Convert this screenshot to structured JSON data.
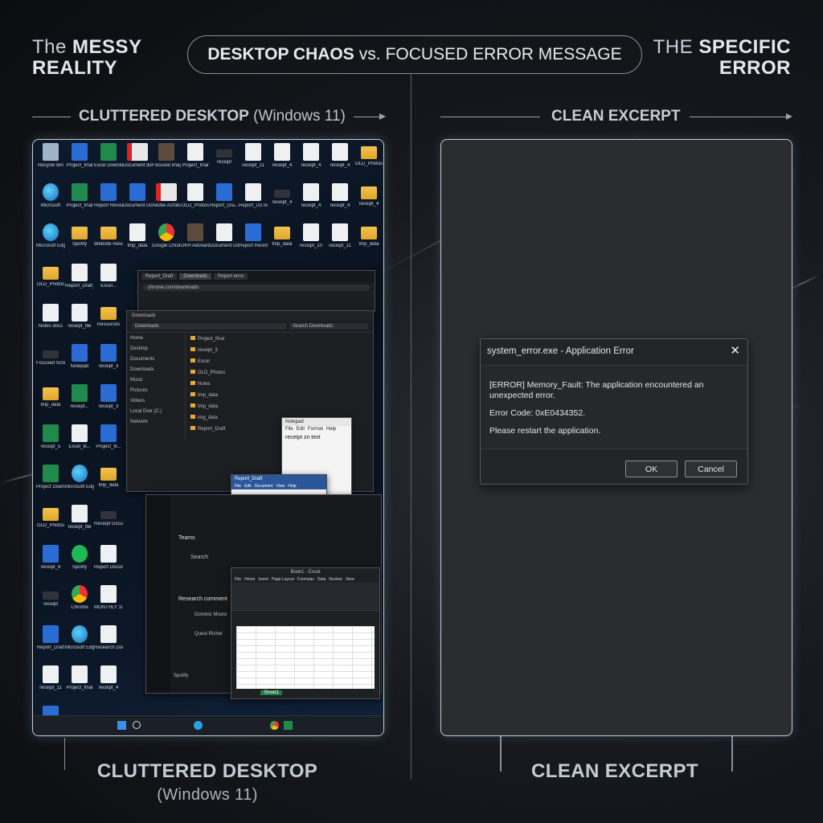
{
  "header": {
    "left_thin": "The",
    "left_bold1": "MESSY",
    "left_bold2": "REALITY",
    "center_bold": "DESKTOP CHAOS",
    "center_thin": "vs.",
    "center_rest": "FOCUSED ERROR MESSAGE",
    "right_thin": "THE",
    "right_bold1": "SPECIFIC",
    "right_bold2": "ERROR"
  },
  "left_section": {
    "label_bold": "CLUTTERED DESKTOP",
    "label_thin": "(Windows 11)"
  },
  "right_section": {
    "label_bold": "CLEAN EXCERPT"
  },
  "desktop": {
    "icons": [
      {
        "t": "Recycle Bin",
        "k": "bin"
      },
      {
        "t": "Project_final",
        "k": "word"
      },
      {
        "t": "Excel Download",
        "k": "excel"
      },
      {
        "t": "Document docs",
        "k": "pdf"
      },
      {
        "t": "Focused image",
        "k": "img"
      },
      {
        "t": "Project_final",
        "k": "doc"
      },
      {
        "t": "receipt",
        "k": "zip"
      },
      {
        "t": "receipt_11",
        "k": "doc"
      },
      {
        "t": "receipt_4",
        "k": "doc"
      },
      {
        "t": "receipt_4",
        "k": "doc"
      },
      {
        "t": "receipt_4",
        "k": "doc"
      },
      {
        "t": "OLD_Photos",
        "k": "folder"
      },
      {
        "t": "Microsoft",
        "k": "edge"
      },
      {
        "t": "Project_final",
        "k": "excel"
      },
      {
        "t": "Report Revised",
        "k": "word"
      },
      {
        "t": "Document Download",
        "k": "word"
      },
      {
        "t": "Adobe Acrobat",
        "k": "pdf"
      },
      {
        "t": "OLD_Photos",
        "k": "doc"
      },
      {
        "t": "Report_Dra...",
        "k": "word"
      },
      {
        "t": "Report_U3 receipts",
        "k": "doc"
      },
      {
        "t": "receipt_4",
        "k": "zip"
      },
      {
        "t": "receipt_4",
        "k": "doc"
      },
      {
        "t": "receipt_4",
        "k": "doc"
      },
      {
        "t": "receipt_4",
        "k": "folder"
      },
      {
        "t": "Microsoft Edge",
        "k": "edge"
      },
      {
        "t": "Spotify",
        "k": "folder"
      },
      {
        "t": "Website Resources",
        "k": "folder"
      },
      {
        "t": "tmp_data",
        "k": "doc"
      },
      {
        "t": "Google Chrome",
        "k": "chrome"
      },
      {
        "t": "DKH Adonard",
        "k": "img"
      },
      {
        "t": "Document Download",
        "k": "doc"
      },
      {
        "t": "Report Reordered",
        "k": "word"
      },
      {
        "t": "tmp_data",
        "k": "folder"
      },
      {
        "t": "receipt_10",
        "k": "doc"
      },
      {
        "t": "receipt_11",
        "k": "doc"
      },
      {
        "t": "tmp_data",
        "k": "folder"
      },
      {
        "t": "OLD_Photos",
        "k": "folder"
      },
      {
        "t": "Report_Draft_ver",
        "k": "doc"
      },
      {
        "t": "Excel...",
        "k": "doc"
      },
      {
        "t": "Notes docs",
        "k": "doc"
      },
      {
        "t": "receipt_file",
        "k": "doc"
      },
      {
        "t": "Resources",
        "k": "folder"
      },
      {
        "t": "Focused Screenshot",
        "k": "zip"
      },
      {
        "t": "Notepad",
        "k": "word"
      },
      {
        "t": "receipt_3",
        "k": "word"
      },
      {
        "t": "tmp_data",
        "k": "folder"
      },
      {
        "t": "receipt...",
        "k": "excel"
      },
      {
        "t": "receipt_3",
        "k": "word"
      },
      {
        "t": "receipt_5",
        "k": "excel"
      },
      {
        "t": "Excel_fil...",
        "k": "doc"
      },
      {
        "t": "Project_fil...",
        "k": "word"
      },
      {
        "t": "Project Download",
        "k": "excel"
      },
      {
        "t": "Microsoft Edge",
        "k": "edge"
      },
      {
        "t": "tmp_data",
        "k": "folder"
      },
      {
        "t": "OLD_Photos",
        "k": "folder"
      },
      {
        "t": "receipt_file",
        "k": "doc"
      },
      {
        "t": "Receipt Document",
        "k": "zip"
      },
      {
        "t": "receipt_9",
        "k": "word"
      },
      {
        "t": "Spotify",
        "k": "spot"
      },
      {
        "t": "Report Document",
        "k": "doc"
      },
      {
        "t": "receipt",
        "k": "zip"
      },
      {
        "t": "Chrome",
        "k": "chrome"
      },
      {
        "t": "MONTHLY 100...",
        "k": "doc"
      },
      {
        "t": "Report_Draft",
        "k": "word"
      },
      {
        "t": "Microsoft Edge",
        "k": "edge"
      },
      {
        "t": "Research Documents",
        "k": "doc"
      },
      {
        "t": "receipt_11",
        "k": "doc"
      },
      {
        "t": "Project_final",
        "k": "doc"
      },
      {
        "t": "receipt_4",
        "k": "doc"
      },
      {
        "t": "OLD_Photos",
        "k": "word"
      }
    ],
    "browser_tabs": [
      "Report_Draft",
      "Downloads",
      "Report error"
    ],
    "browser_url": "chrome.com/downloads",
    "explorer": {
      "title": "Downloads",
      "path": "Downloads",
      "search": "Search Downloads",
      "nav": [
        "Home",
        "Desktop",
        "Documents",
        "Downloads",
        "Music",
        "Pictures",
        "Videos",
        "Local Disk (C:)",
        "Network"
      ],
      "files": [
        "Project_final",
        "receipt_3",
        "Excel",
        "OLD_Photos",
        "Notes",
        "tmp_data",
        "tmp_data",
        "img_data",
        "Report_Draft"
      ]
    },
    "notepad": {
      "title": "Notepad",
      "menu": [
        "File",
        "Edit",
        "Format",
        "Help"
      ],
      "text": "receipt zn text"
    },
    "word": {
      "title": "Report_Draft",
      "menu": [
        "File",
        "Edit",
        "Document",
        "View",
        "Help"
      ],
      "text": "Report_Draft"
    },
    "teams": {
      "title": "Teams",
      "search": "Search",
      "label": "Research comment",
      "contacts": [
        "Dominic Moore",
        "Quest Richer"
      ],
      "footer": "Spotify"
    },
    "excel": {
      "title": "Book1 - Excel",
      "menu": [
        "File",
        "Home",
        "Insert",
        "Page Layout",
        "Formulas",
        "Data",
        "Review",
        "View"
      ],
      "sheet": "Sheet1"
    }
  },
  "dialog": {
    "title": "system_error.exe - Application Error",
    "line1": "[ERROR] Memory_Fault: The application encountered an unexpected error.",
    "line2": "Error Code: 0xE0434352.",
    "line3": "Please restart the application.",
    "ok": "OK",
    "cancel": "Cancel"
  },
  "footer": {
    "left_bold": "CLUTTERED DESKTOP",
    "left_thin": "(Windows 11)",
    "right_bold": "CLEAN EXCERPT"
  }
}
